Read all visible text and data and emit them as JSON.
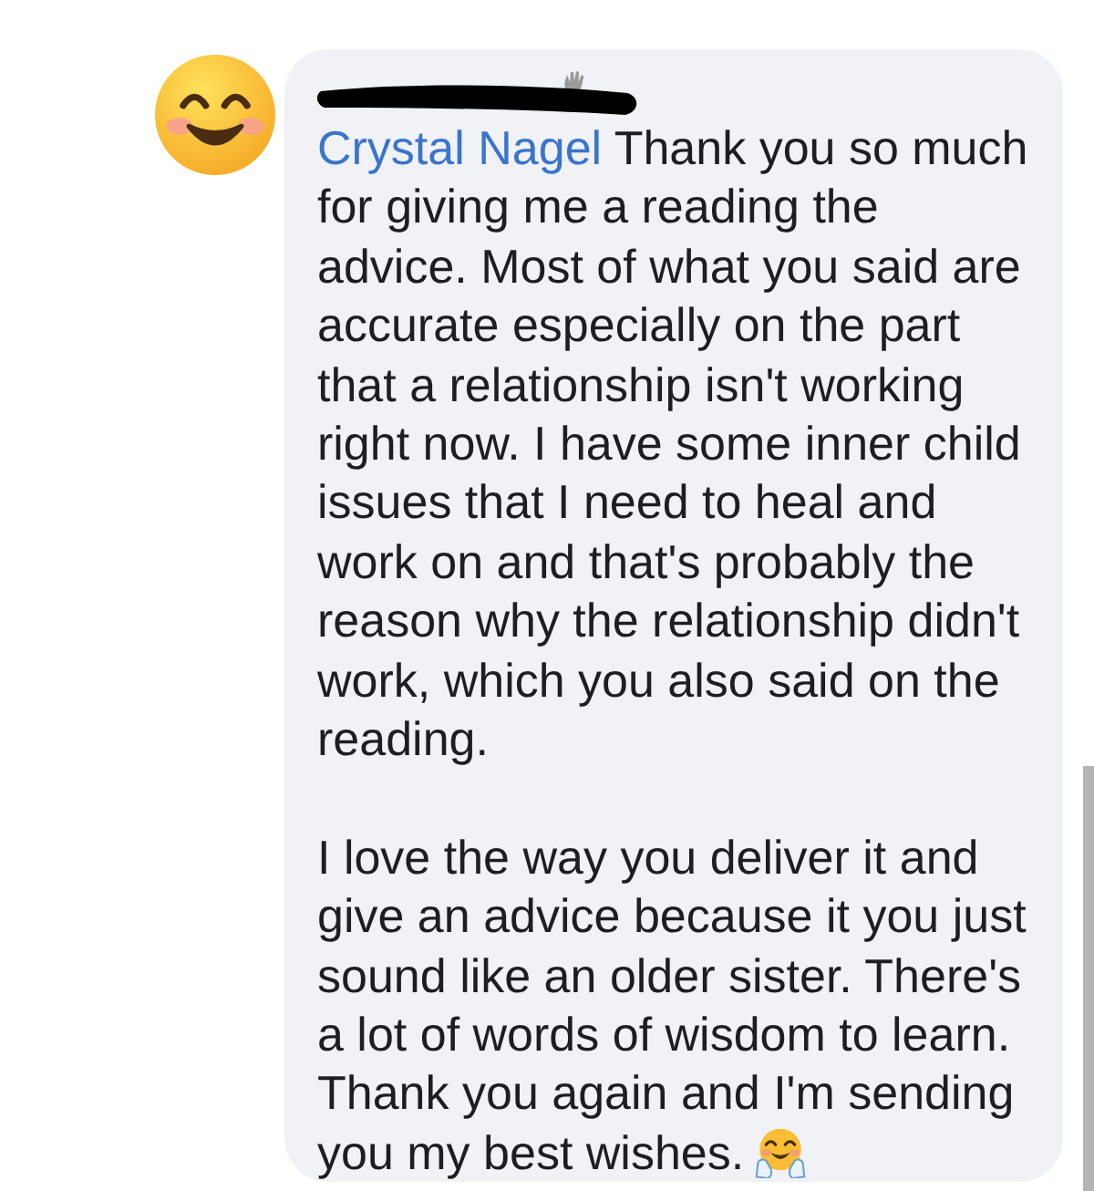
{
  "comment": {
    "mention": "Crystal Nagel",
    "paragraphs": [
      "Thank you so much for giving me a reading the advice. Most of what you said are accurate especially on the part that a relationship isn't working right now. I have some inner child issues that I need to heal and work on and that's probably the reason why the relationship didn't work, which you also said on the reading.",
      "I love the way you deliver it and give an advice because it you just sound like an older sister. There's a lot of words of wisdom to learn. Thank you again and I'm sending you my best wishes."
    ]
  }
}
